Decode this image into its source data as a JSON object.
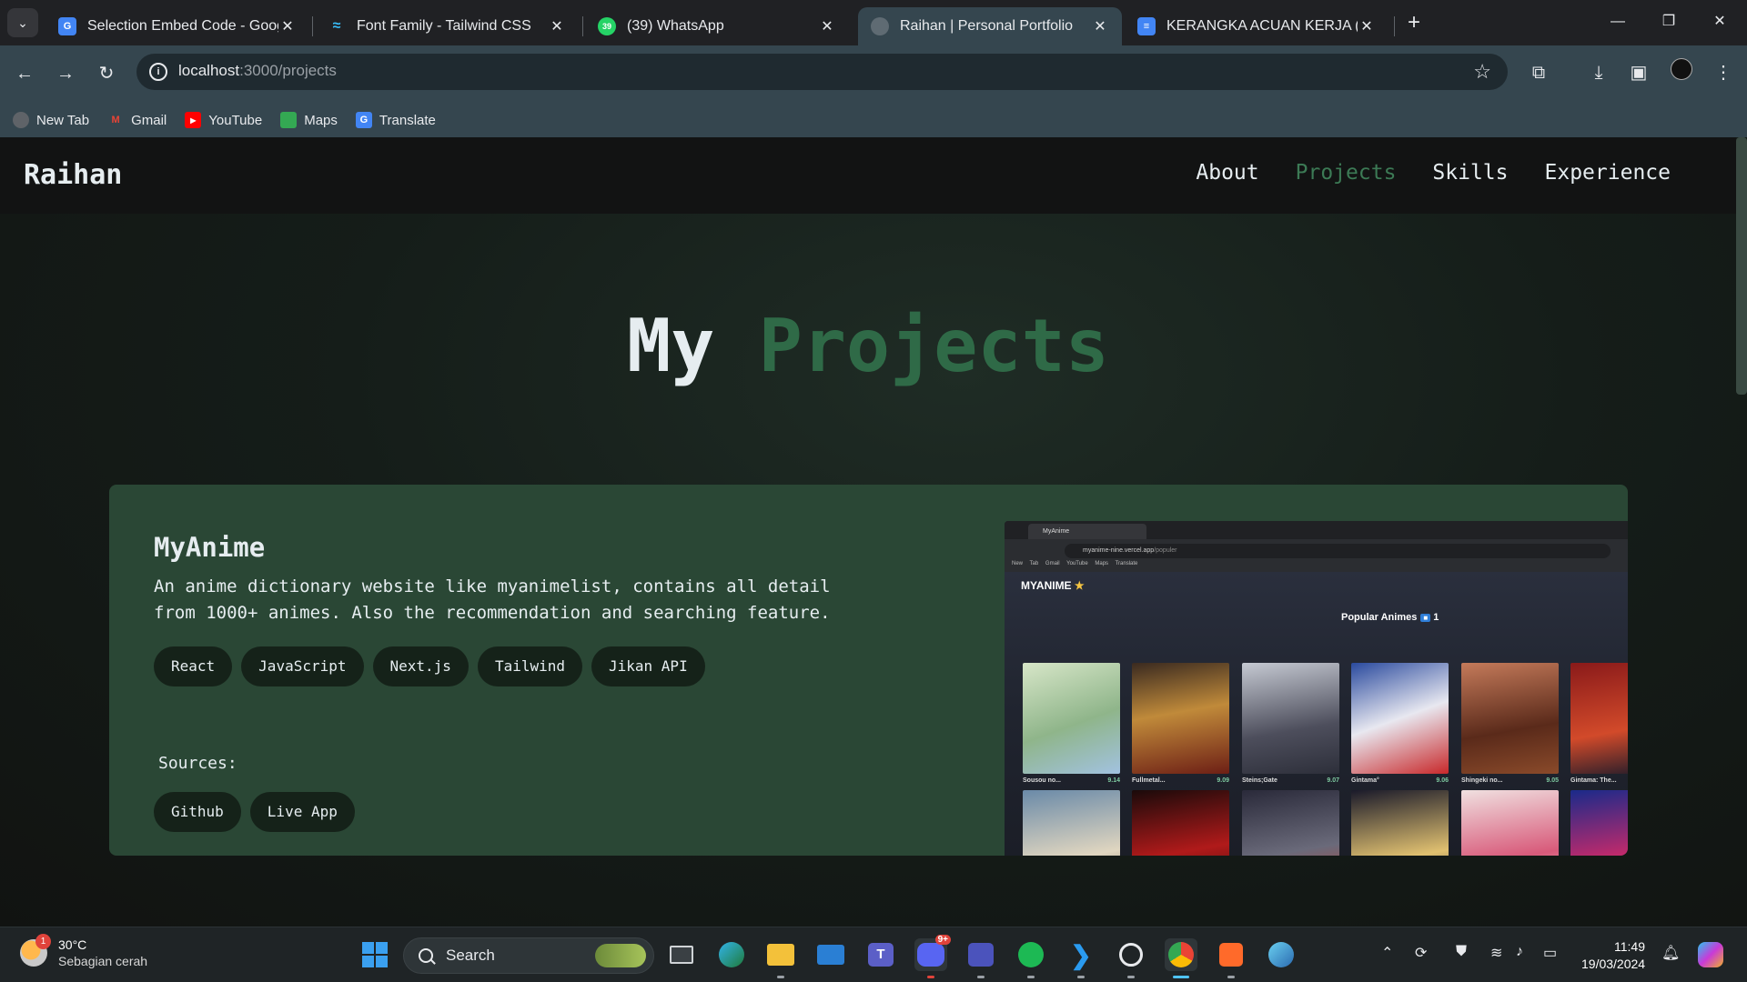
{
  "browser": {
    "tabs": [
      {
        "title": "Selection Embed Code - Google",
        "icon": "google-apps-icon",
        "color": "#4285f4"
      },
      {
        "title": "Font Family - Tailwind CSS",
        "icon": "tailwind-icon",
        "color": "#38bdf8"
      },
      {
        "title": "(39) WhatsApp",
        "icon": "whatsapp-icon",
        "color": "#25d366",
        "badge": "39"
      },
      {
        "title": "Raihan | Personal Portfolio",
        "icon": "globe-icon",
        "color": "#9aa0a6",
        "active": true
      },
      {
        "title": "KERANGKA ACUAN KERJA (TERI",
        "icon": "docs-icon",
        "color": "#4285f4"
      }
    ],
    "url_host": "localhost",
    "url_path": ":3000/projects",
    "bookmarks": [
      {
        "label": "New Tab",
        "icon": "globe-icon",
        "color": "#5f6368"
      },
      {
        "label": "Gmail",
        "icon": "gmail-icon",
        "color": "#ea4335"
      },
      {
        "label": "YouTube",
        "icon": "youtube-icon",
        "color": "#ff0000"
      },
      {
        "label": "Maps",
        "icon": "maps-icon",
        "color": "#34a853"
      },
      {
        "label": "Translate",
        "icon": "translate-icon",
        "color": "#4285f4"
      }
    ]
  },
  "site": {
    "brand": "Raihan",
    "nav": [
      "About",
      "Projects",
      "Skills",
      "Experience"
    ],
    "active_nav": "Projects",
    "accent_color": "#3c7a55",
    "hero": {
      "word1": "My",
      "word2": "Projects"
    }
  },
  "project": {
    "title": "MyAnime",
    "description": "An anime dictionary website like myanimelist, contains all detail from 1000+ animes. Also the recommendation and searching feature.",
    "tech": [
      "React",
      "JavaScript",
      "Next.js",
      "Tailwind",
      "Jikan API"
    ],
    "sources_label": "Sources:",
    "sources": [
      "Github",
      "Live App"
    ],
    "preview": {
      "tab_title": "MyAnime",
      "url_host": "myanime-nine.vercel.app",
      "url_path": "/populer",
      "bookmarks": "New Tab  Gmail  YouTube  Maps  Translate",
      "logo": "MYANIME",
      "heading": "Popular Animes",
      "page_badge": "1",
      "animes": [
        {
          "name": "Sousou no...",
          "score": "9.14"
        },
        {
          "name": "Fullmetal...",
          "score": "9.09"
        },
        {
          "name": "Steins;Gate",
          "score": "9.07"
        },
        {
          "name": "Gintama°",
          "score": "9.06"
        },
        {
          "name": "Shingeki no...",
          "score": "9.05"
        },
        {
          "name": "Gintama: The...",
          "score": ""
        }
      ]
    }
  },
  "taskbar": {
    "weather_temp": "30°C",
    "weather_desc": "Sebagian cerah",
    "weather_alert": "1",
    "search_placeholder": "Search",
    "time": "11:49",
    "date": "19/03/2024",
    "discord_badge": "9+"
  }
}
